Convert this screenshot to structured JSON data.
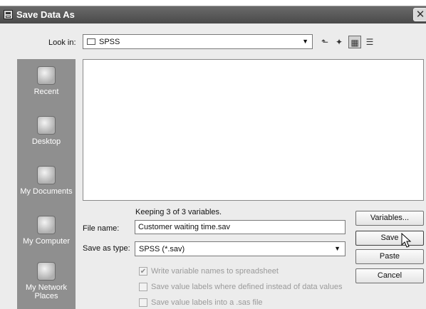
{
  "window": {
    "title": "Save Data As",
    "close_glyph": "✕"
  },
  "lookin": {
    "label": "Look in:",
    "value": "SPSS"
  },
  "toolbar": {
    "up_icon": "up-folder-icon",
    "new_folder_icon": "new-folder-icon",
    "list_view_icon": "list-view-icon",
    "details_view_icon": "details-view-icon"
  },
  "places": [
    {
      "label": "Recent",
      "icon": "recent-icon"
    },
    {
      "label": "Desktop",
      "icon": "desktop-icon"
    },
    {
      "label": "My Documents",
      "icon": "documents-icon"
    },
    {
      "label": "My Computer",
      "icon": "computer-icon"
    },
    {
      "label": "My Network Places",
      "icon": "network-icon"
    }
  ],
  "status": {
    "keeping_text": "Keeping 3 of 3 variables."
  },
  "filename": {
    "label": "File name:",
    "value": "Customer waiting time.sav"
  },
  "savetype": {
    "label": "Save as type:",
    "value": "SPSS (*.sav)"
  },
  "options": [
    {
      "label": "Write variable names to spreadsheet",
      "checked": true,
      "enabled": false
    },
    {
      "label": "Save value labels where defined instead of data values",
      "checked": false,
      "enabled": false
    },
    {
      "label": "Save value labels into a .sas file",
      "checked": false,
      "enabled": false
    }
  ],
  "buttons": {
    "variables": "Variables...",
    "save": "Save",
    "paste": "Paste",
    "cancel": "Cancel"
  },
  "colors": {
    "titlebar": "#555555",
    "places_bar": "#8f8f8f",
    "dialog_bg": "#ececec"
  }
}
